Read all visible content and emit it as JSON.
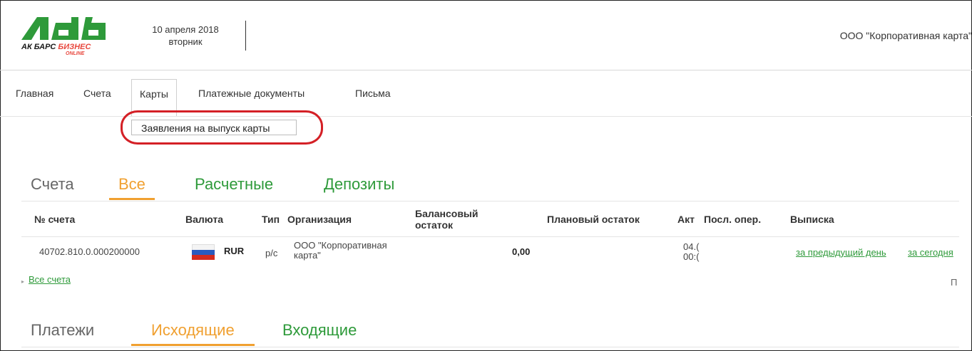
{
  "header": {
    "logo_text_part1": "АК БАРС",
    "logo_text_part2": "БИЗНЕС",
    "logo_sub": "ONLINE",
    "date": "10 апреля 2018",
    "weekday": "вторник",
    "org_name": "ООО \"Корпоративная карта\""
  },
  "nav": {
    "items": [
      "Главная",
      "Счета",
      "Карты",
      "Платежные документы",
      "Письма"
    ],
    "active": "Карты",
    "dropdown_item": "Заявления на выпуск карты"
  },
  "accounts_section": {
    "title": "Счета",
    "tabs": [
      "Все",
      "Расчетные",
      "Депозиты"
    ],
    "selected_tab": "Все",
    "columns": [
      "№ счета",
      "Валюта",
      "Тип",
      "Организация",
      "Балансовый остаток",
      "Плановый остаток",
      "Акт",
      "Посл. опер.",
      "Выписка"
    ],
    "rows": [
      {
        "account": "40702.810.0.000200000",
        "currency": "RUR",
        "type": "р/с",
        "organization": "ООО \"Корпоративная карта\"",
        "balance": "0,00",
        "planned": "",
        "act_line1": "04.(",
        "act_line2": "00:(",
        "statement_prev": "за предыдущий день",
        "statement_today": "за сегодня"
      }
    ],
    "all_accounts_link": "Все счета",
    "right_marker": "П"
  },
  "payments_section": {
    "title": "Платежи",
    "tabs": [
      "Исходящие",
      "Входящие"
    ],
    "selected_tab": "Исходящие"
  },
  "colors": {
    "brand_green": "#2e9a3a",
    "accent_orange": "#f0a030",
    "highlight_red": "#d42026"
  }
}
